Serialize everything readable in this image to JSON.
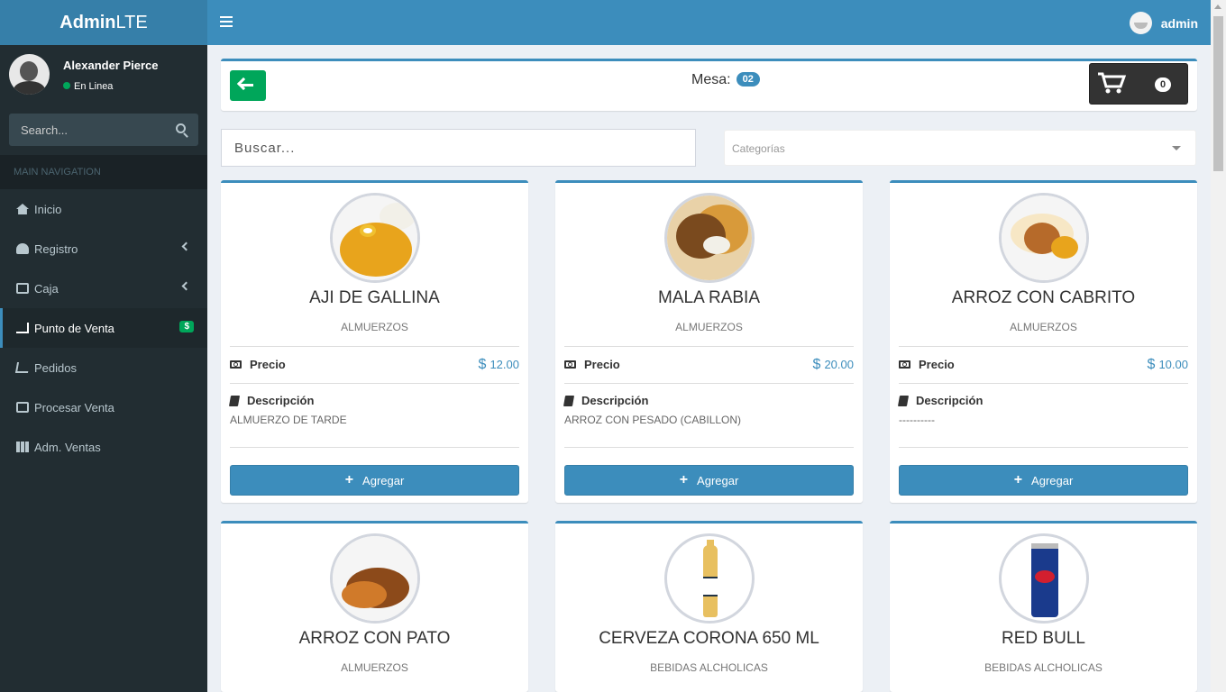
{
  "header": {
    "logo_bold": "Admin",
    "logo_rest": "LTE",
    "user_name": "admin"
  },
  "sidebar": {
    "user": {
      "name": "Alexander Pierce",
      "status": "En Linea"
    },
    "search_placeholder": "Search...",
    "nav_header": "MAIN NAVIGATION",
    "items": [
      {
        "label": "Inicio",
        "icon": "home-icon"
      },
      {
        "label": "Registro",
        "icon": "dashboard-icon"
      },
      {
        "label": "Caja",
        "icon": "inbox-icon"
      },
      {
        "label": "Punto de Venta",
        "icon": "cart-icon",
        "badge": "$"
      },
      {
        "label": "Pedidos",
        "icon": "cart-outline-icon"
      },
      {
        "label": "Procesar Venta",
        "icon": "money-icon"
      },
      {
        "label": "Adm. Ventas",
        "icon": "grid-icon"
      }
    ]
  },
  "toolbar": {
    "mesa_label": "Mesa:",
    "mesa_number": "02",
    "cart_count": "0"
  },
  "filters": {
    "search_placeholder": "Buscar...",
    "category_placeholder": "Categorías"
  },
  "labels": {
    "precio": "Precio",
    "descripcion": "Descripción",
    "agregar": "Agregar",
    "currency": "$"
  },
  "products": [
    {
      "name": "AJI DE GALLINA",
      "category": "ALMUERZOS",
      "price": "12.00",
      "description": "ALMUERZO DE TARDE"
    },
    {
      "name": "MALA RABIA",
      "category": "ALMUERZOS",
      "price": "20.00",
      "description": "ARROZ CON PESADO (CABILLON)"
    },
    {
      "name": "ARROZ CON CABRITO",
      "category": "ALMUERZOS",
      "price": "10.00",
      "description": "----------"
    },
    {
      "name": "ARROZ CON PATO",
      "category": "ALMUERZOS"
    },
    {
      "name": "CERVEZA CORONA 650 ML",
      "category": "BEBIDAS ALCHOLICAS"
    },
    {
      "name": "RED BULL",
      "category": "BEBIDAS ALCHOLICAS"
    }
  ]
}
